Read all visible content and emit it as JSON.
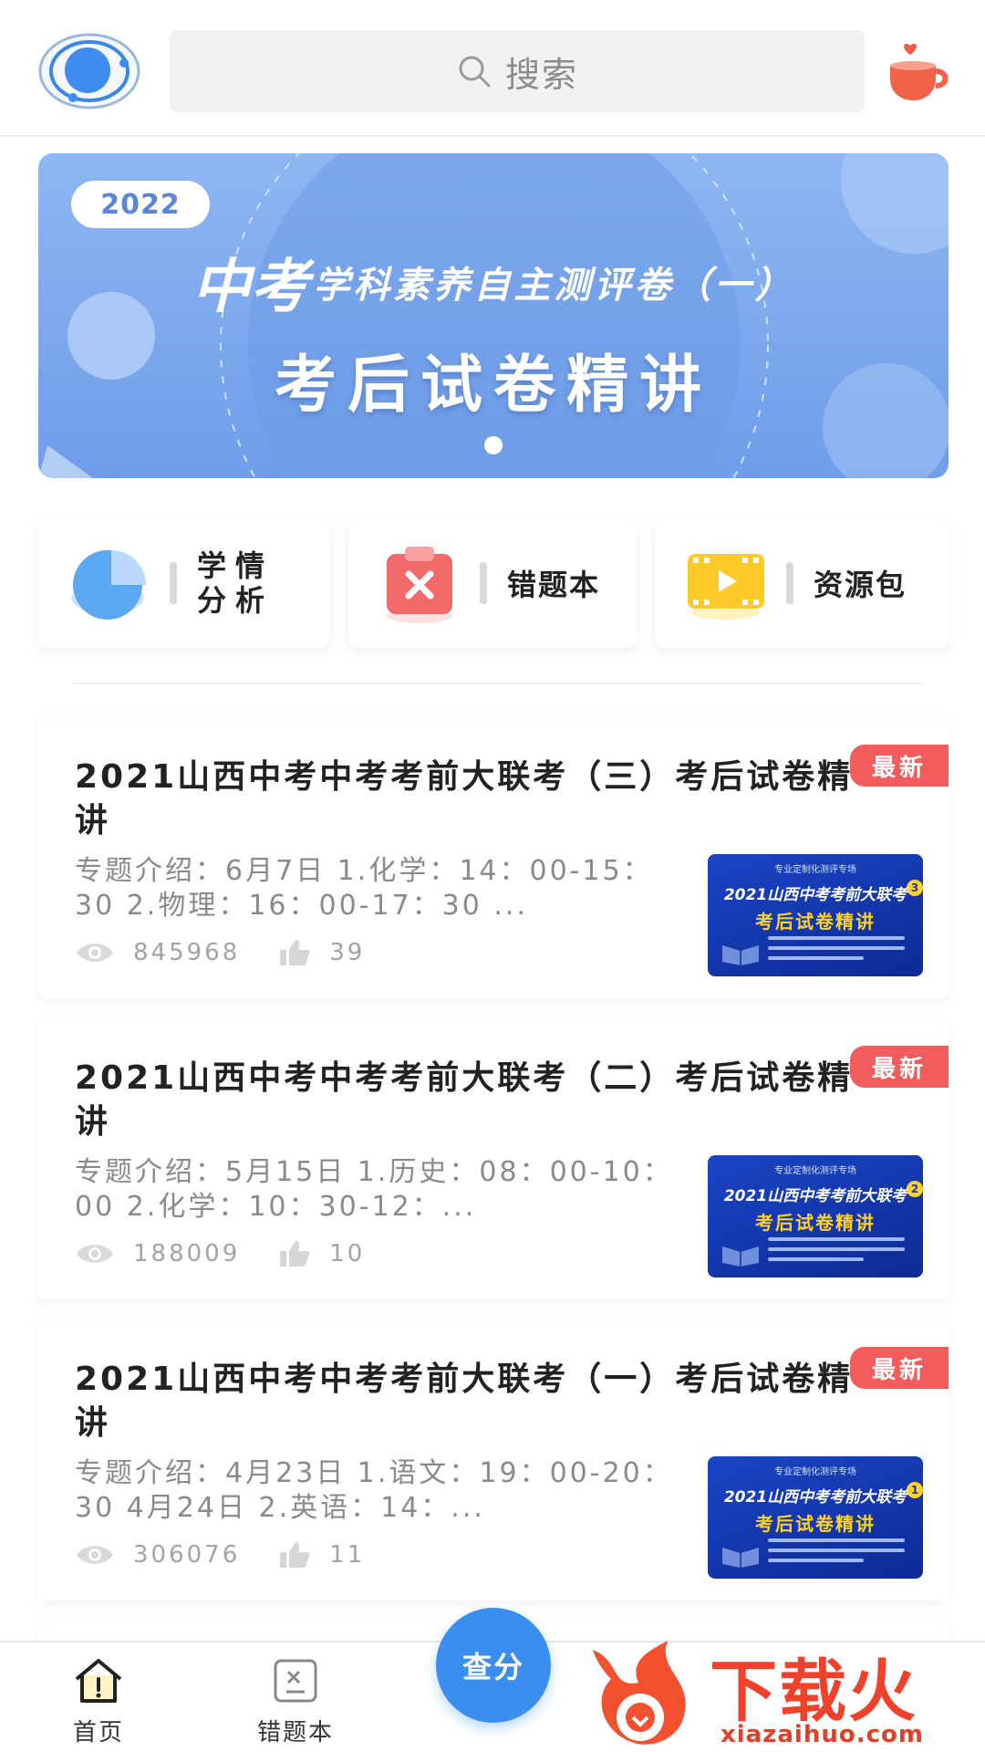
{
  "header": {
    "search_placeholder": "搜索",
    "logo_icon": "app-logo-icon",
    "right_icon": "coffee-cup-icon"
  },
  "banner": {
    "year": "2022",
    "title_big": "中考",
    "title_sub": "学科素养自主测评卷（一）",
    "title_main": "考后试卷精讲",
    "page_indicator_count": 1
  },
  "quick": {
    "analysis_label": "学情分析",
    "wrongbook_label": "错题本",
    "resources_label": "资源包"
  },
  "cards": [
    {
      "badge": "最新",
      "title": "2021山西中考中考考前大联考（三）考后试卷精讲",
      "desc": "专题介绍：6月7日 1.化学：14：00-15：30 2.物理：16：00-17：30 ...",
      "views": "845968",
      "likes": "39",
      "thumb": {
        "num": "3",
        "top": "专业定制化测评专场",
        "mid": "2021山西中考考前大联考",
        "main": "考后试卷精讲"
      }
    },
    {
      "badge": "最新",
      "title": "2021山西中考中考考前大联考（二）考后试卷精讲",
      "desc": "专题介绍：5月15日 1.历史：08：00-10：00 2.化学：10：30-12：...",
      "views": "188009",
      "likes": "10",
      "thumb": {
        "num": "2",
        "top": "专业定制化测评专场",
        "mid": "2021山西中考考前大联考",
        "main": "考后试卷精讲"
      }
    },
    {
      "badge": "最新",
      "title": "2021山西中考中考考前大联考（一）考后试卷精讲",
      "desc": "专题介绍：4月23日 1.语文：19：00-20：30 4月24日 2.英语：14：...",
      "views": "306076",
      "likes": "11",
      "thumb": {
        "num": "1",
        "top": "专业定制化测评专场",
        "mid": "2021山西中考考前大联考",
        "main": "考后试卷精讲"
      }
    }
  ],
  "tabbar": {
    "home_label": "首页",
    "wrongbook_label": "错题本",
    "score_label": "查分"
  },
  "watermark": {
    "main": "下载火",
    "url": "xiazaihuo.com"
  },
  "colors": {
    "accent": "#3a8ef0",
    "badge": "#f25c5c",
    "banner": "#7ea7ee"
  }
}
